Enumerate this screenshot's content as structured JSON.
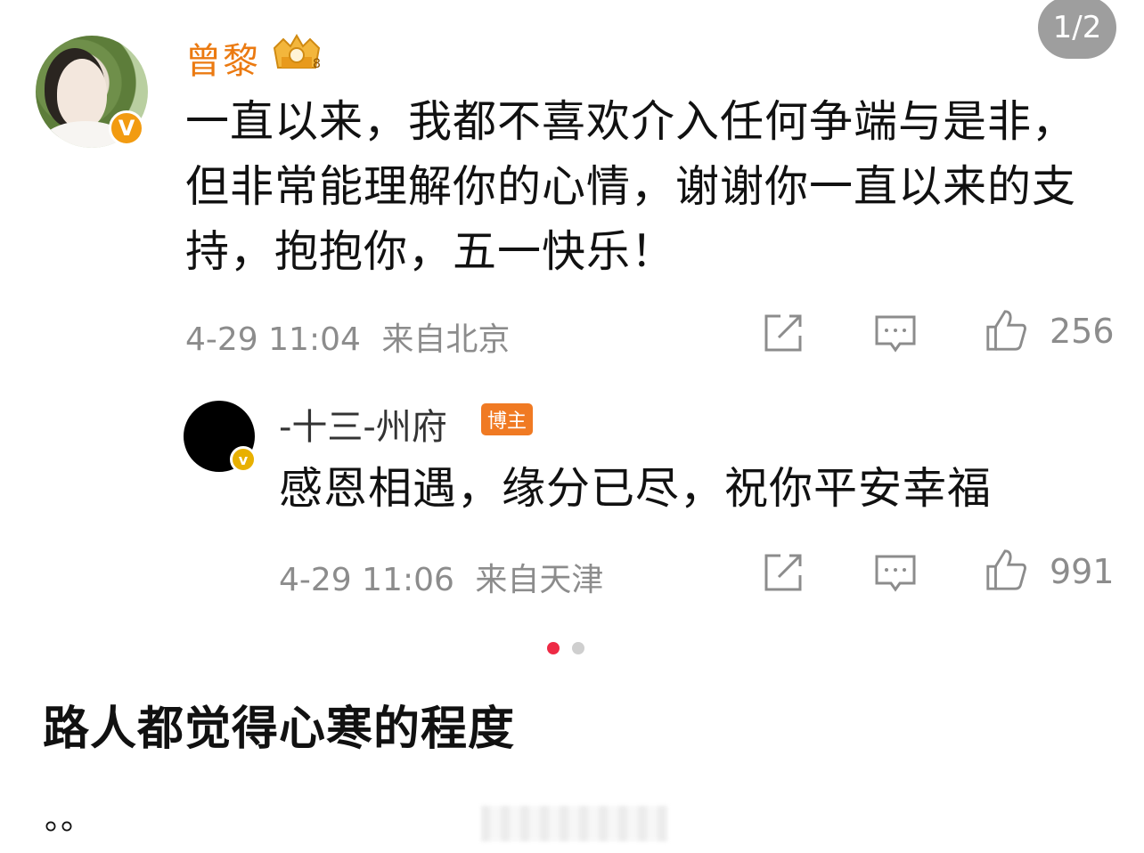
{
  "page_counter": "1/2",
  "comment": {
    "author": "曾黎",
    "verified_mark": "V",
    "crown_badge_text": "8",
    "text": "一直以来，我都不喜欢介入任何争端与是非，但非常能理解你的心情，谢谢你一直以来的支持，抱抱你，五一快乐！",
    "time": "4-29 11:04",
    "location": "来自北京",
    "likes": "256",
    "icons": [
      "share-icon",
      "comment-icon",
      "like-icon"
    ]
  },
  "reply": {
    "author": "-十三-州府",
    "role_tag": "博主",
    "verified_mark": "v",
    "text": "感恩相遇，缘分已尽，祝你平安幸福",
    "time": "4-29 11:06",
    "location": "来自天津",
    "likes": "991",
    "icons": [
      "share-icon",
      "comment-icon",
      "like-icon"
    ]
  },
  "pagination": {
    "current": 1,
    "total": 2
  },
  "post_caption": "路人都觉得心寒的程度",
  "post_trailing": "。。",
  "colors": {
    "name_orange": "#eb7a11",
    "verified_orange": "#f29b11",
    "tag_orange": "#f07a23",
    "dot_active": "#ee2a45",
    "meta_gray": "#8c8c8c"
  }
}
